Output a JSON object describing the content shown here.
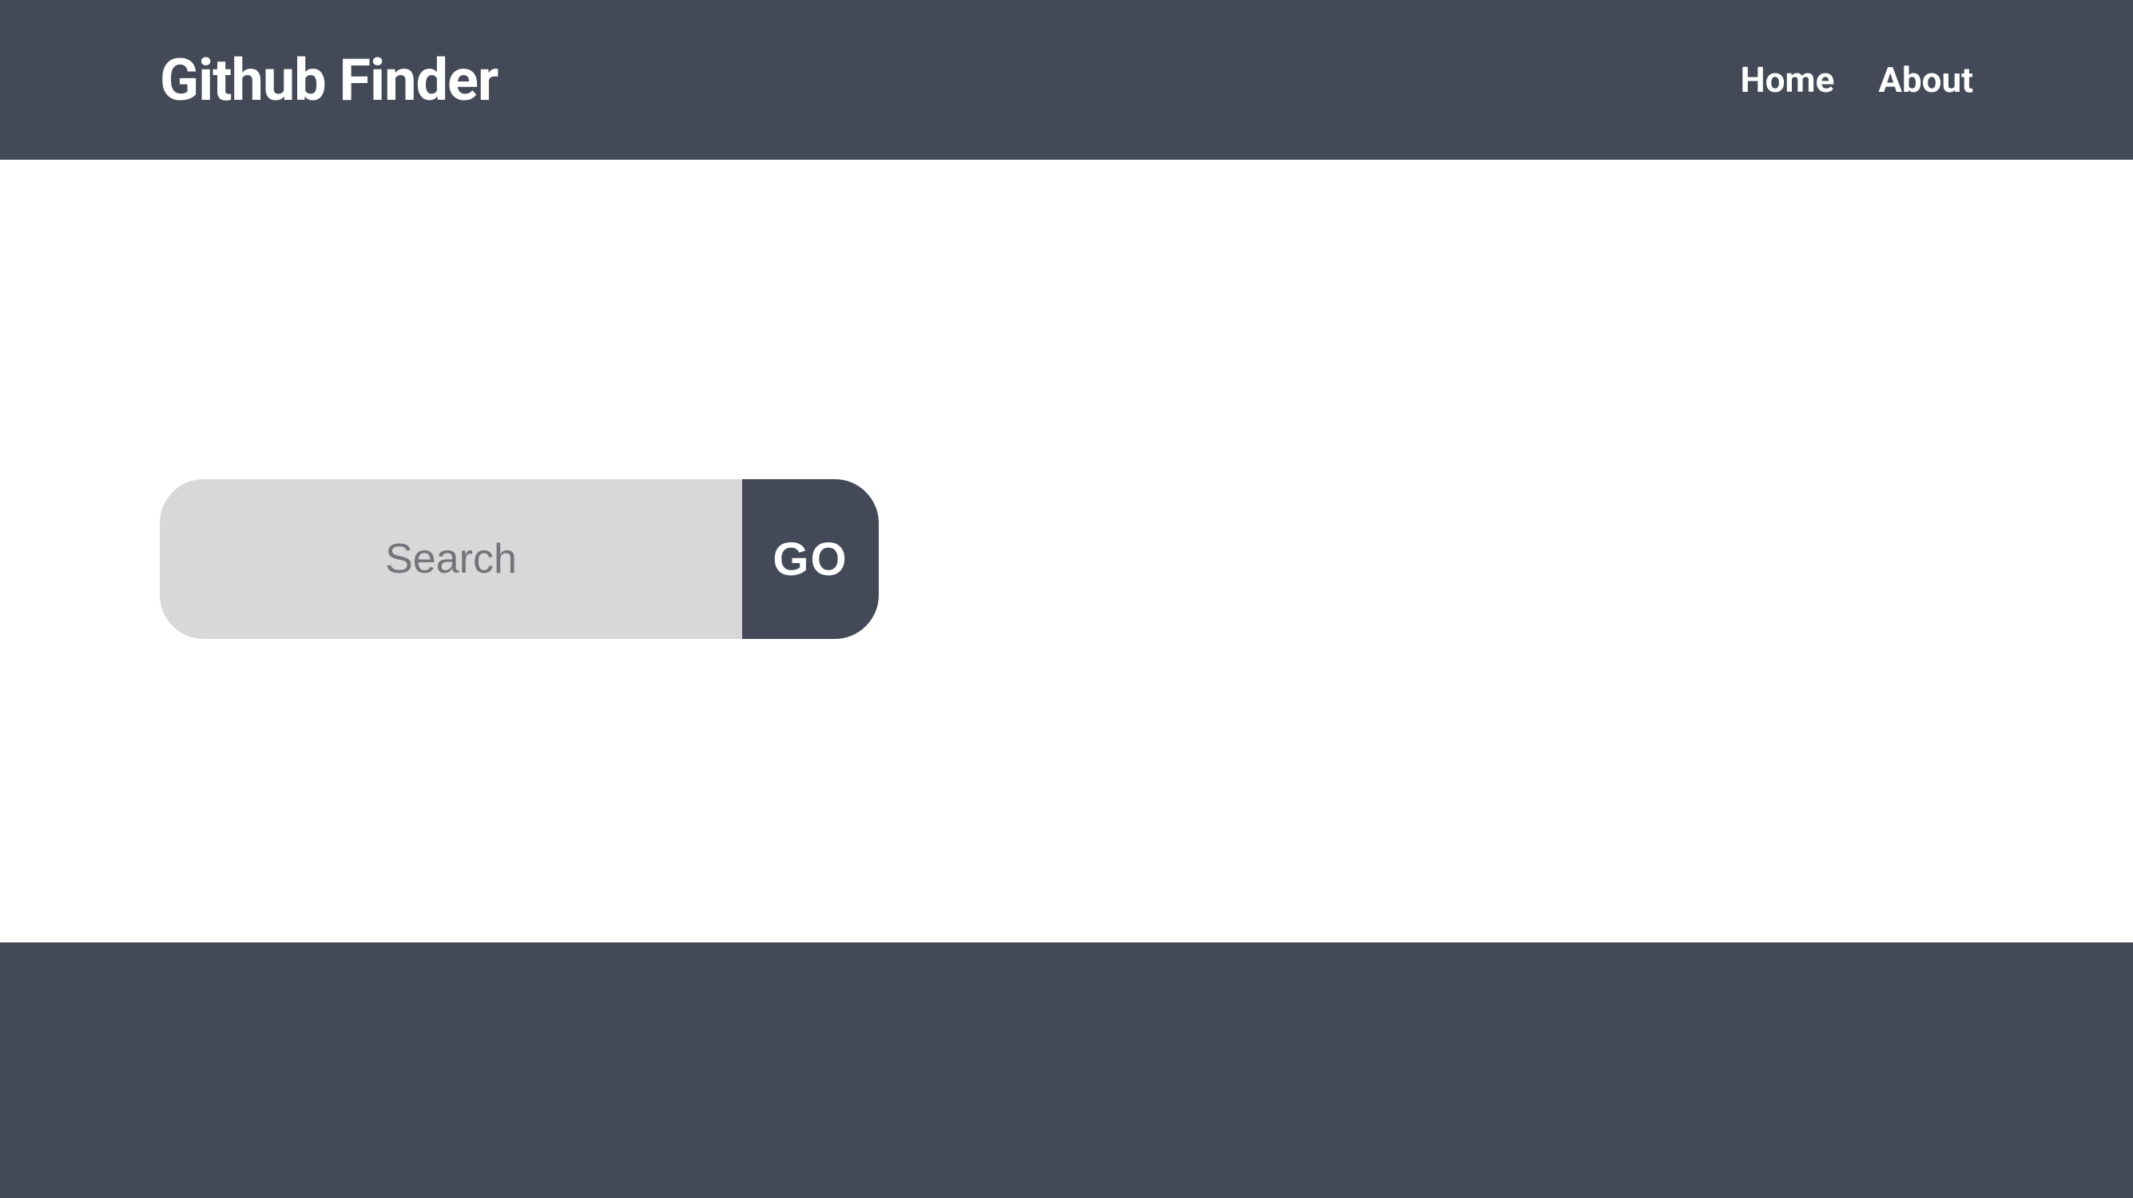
{
  "navbar": {
    "title": "Github Finder",
    "links": {
      "home": "Home",
      "about": "About"
    }
  },
  "search": {
    "placeholder": "Search",
    "value": "",
    "button_label": "GO"
  }
}
